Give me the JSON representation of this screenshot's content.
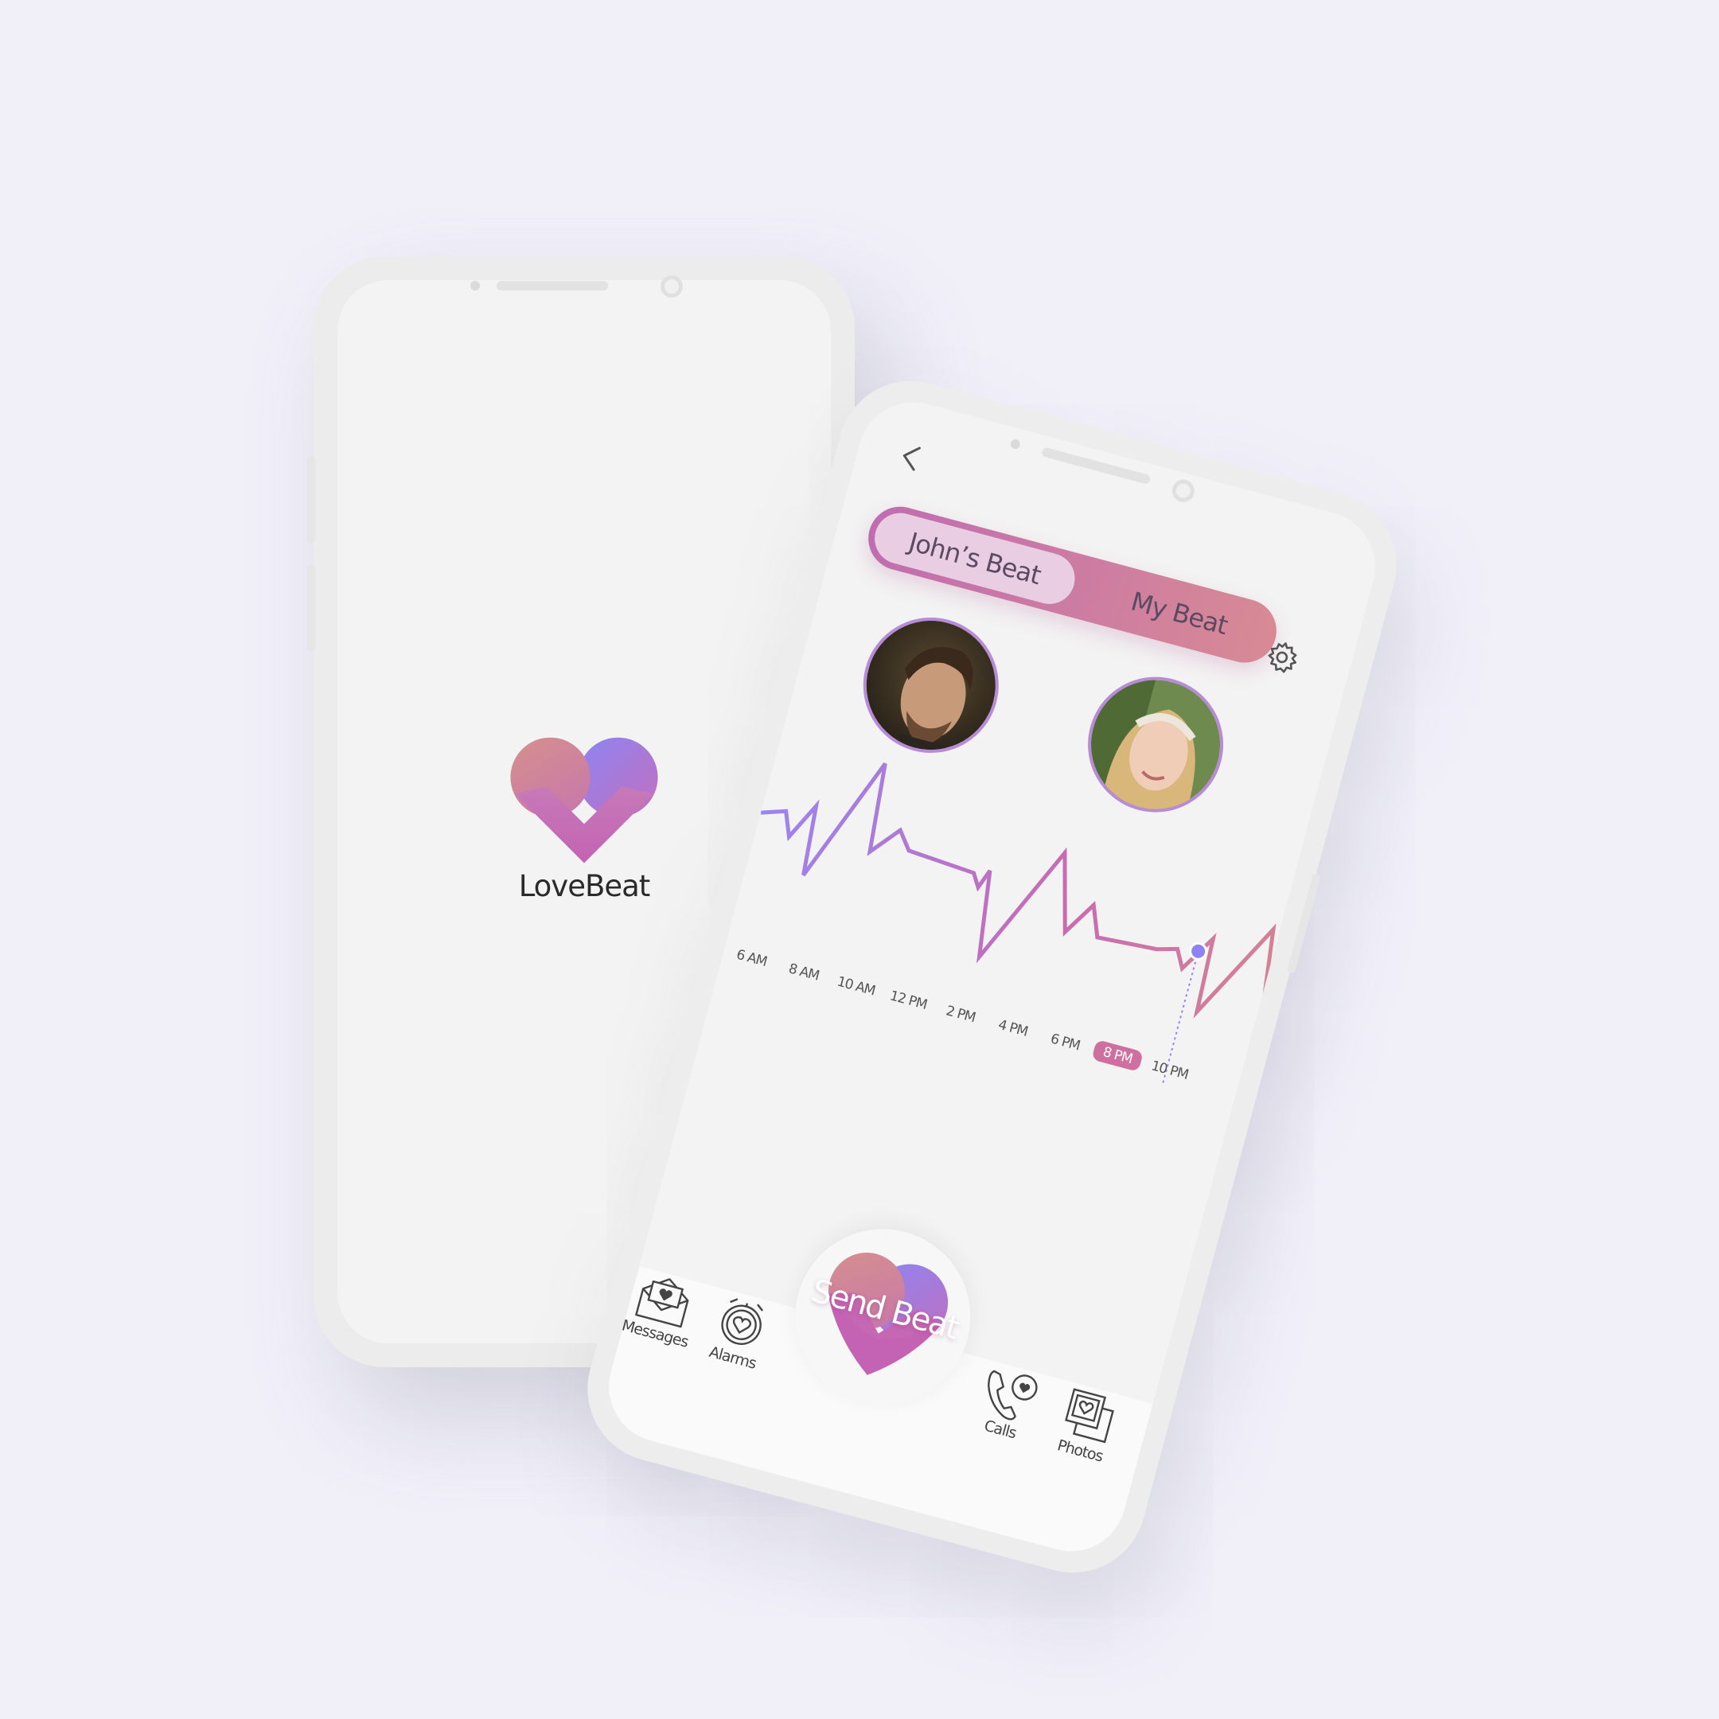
{
  "app": {
    "name": "LoveBeat"
  },
  "colors": {
    "accent_purple": "#9a85f0",
    "accent_pink": "#c86bb2",
    "accent_rose": "#d6868e",
    "selected_time": "#cf6fa0"
  },
  "beat_screen": {
    "tabs": [
      {
        "label": "John’s Beat",
        "active": true
      },
      {
        "label": "My Beat",
        "active": false
      }
    ],
    "time_axis": [
      "6 AM",
      "8 AM",
      "10 AM",
      "12 PM",
      "2 PM",
      "4 PM",
      "6 PM",
      "8 PM",
      "10 PM"
    ],
    "selected_time": "8 PM",
    "send_button_label": "Send Beat",
    "nav": [
      {
        "label": "Messages",
        "icon": "envelope-heart-icon"
      },
      {
        "label": "Alarms",
        "icon": "alarm-clock-heart-icon"
      },
      {
        "label": "Calls",
        "icon": "phone-heart-icon"
      },
      {
        "label": "Photos",
        "icon": "photos-heart-icon"
      }
    ],
    "icons": {
      "back": "chevron-left-icon",
      "settings": "gear-icon"
    }
  }
}
